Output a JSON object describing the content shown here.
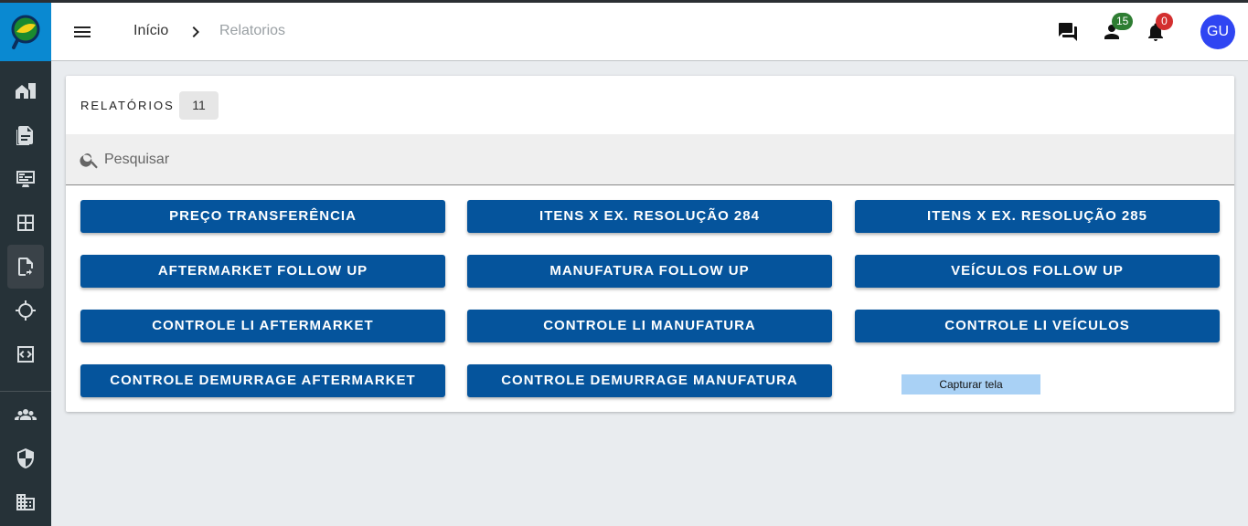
{
  "header": {
    "breadcrumb_home": "Início",
    "breadcrumb_current": "Relatorios",
    "people_badge": "15",
    "notifications_badge": "0",
    "avatar_initials": "GU"
  },
  "sidebar": {
    "items": [
      {
        "icon": "home-city-icon"
      },
      {
        "icon": "document-icon"
      },
      {
        "icon": "monitor-dashboard-icon"
      },
      {
        "icon": "grid-icon"
      },
      {
        "icon": "file-swap-icon",
        "active": true
      },
      {
        "icon": "crosshair-icon"
      },
      {
        "icon": "code-icon"
      },
      {
        "icon": "group-icon"
      },
      {
        "icon": "shield-icon"
      },
      {
        "icon": "building-icon"
      }
    ]
  },
  "reports": {
    "title": "RELATÓRIOS",
    "count": "11",
    "search_placeholder": "Pesquisar",
    "buttons": [
      "PREÇO TRANSFERÊNCIA",
      "ITENS X EX. RESOLUÇÃO 284",
      "ITENS X EX. RESOLUÇÃO 285",
      "AFTERMARKET FOLLOW UP",
      "MANUFATURA FOLLOW UP",
      "VEÍCULOS FOLLOW UP",
      "CONTROLE LI AFTERMARKET",
      "CONTROLE LI MANUFATURA",
      "CONTROLE LI VEÍCULOS",
      "CONTROLE DEMURRAGE AFTERMARKET",
      "CONTROLE DEMURRAGE MANUFATURA"
    ]
  },
  "overlay": {
    "capture_label": "Capturar tela"
  },
  "colors": {
    "sidebar_bg": "#263238",
    "brand_blue": "#0a89d1",
    "button_bg": "#05549c",
    "badge_green": "#2e7d32",
    "badge_red": "#d32f2f",
    "avatar_bg": "#2f45f2"
  }
}
